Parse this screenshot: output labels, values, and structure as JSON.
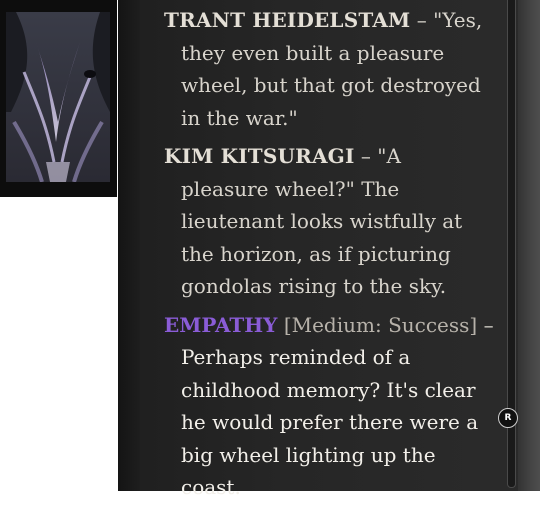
{
  "dialogue": {
    "entries": [
      {
        "speaker": "TRANT HEIDELSTAM",
        "separator": " – ",
        "text": "\"Yes, they even built a pleasure wheel, but that got destroyed in the war.\""
      },
      {
        "speaker": "KIM KITSURAGI",
        "separator": " – ",
        "text": "\"A pleasure wheel?\" The lieutenant looks wistfully at the horizon, as if picturing gondolas rising to the sky."
      },
      {
        "skill": "EMPATHY",
        "check": "[Medium: Success]",
        "separator": " – ",
        "text": "Perhaps reminded of a childhood memory? It's clear he would prefer there were a big wheel lighting up the coast."
      }
    ]
  },
  "scrollbar": {
    "badge_label": "R"
  },
  "colors": {
    "panel_bg": "#262626",
    "speaker_text": "#e4dfd6",
    "skill_empathy": "#8a5cd6",
    "body_text": "#d8d4cc"
  },
  "icons": {
    "portrait": "character-portrait-icon",
    "scroll_badge": "r-key-icon"
  }
}
